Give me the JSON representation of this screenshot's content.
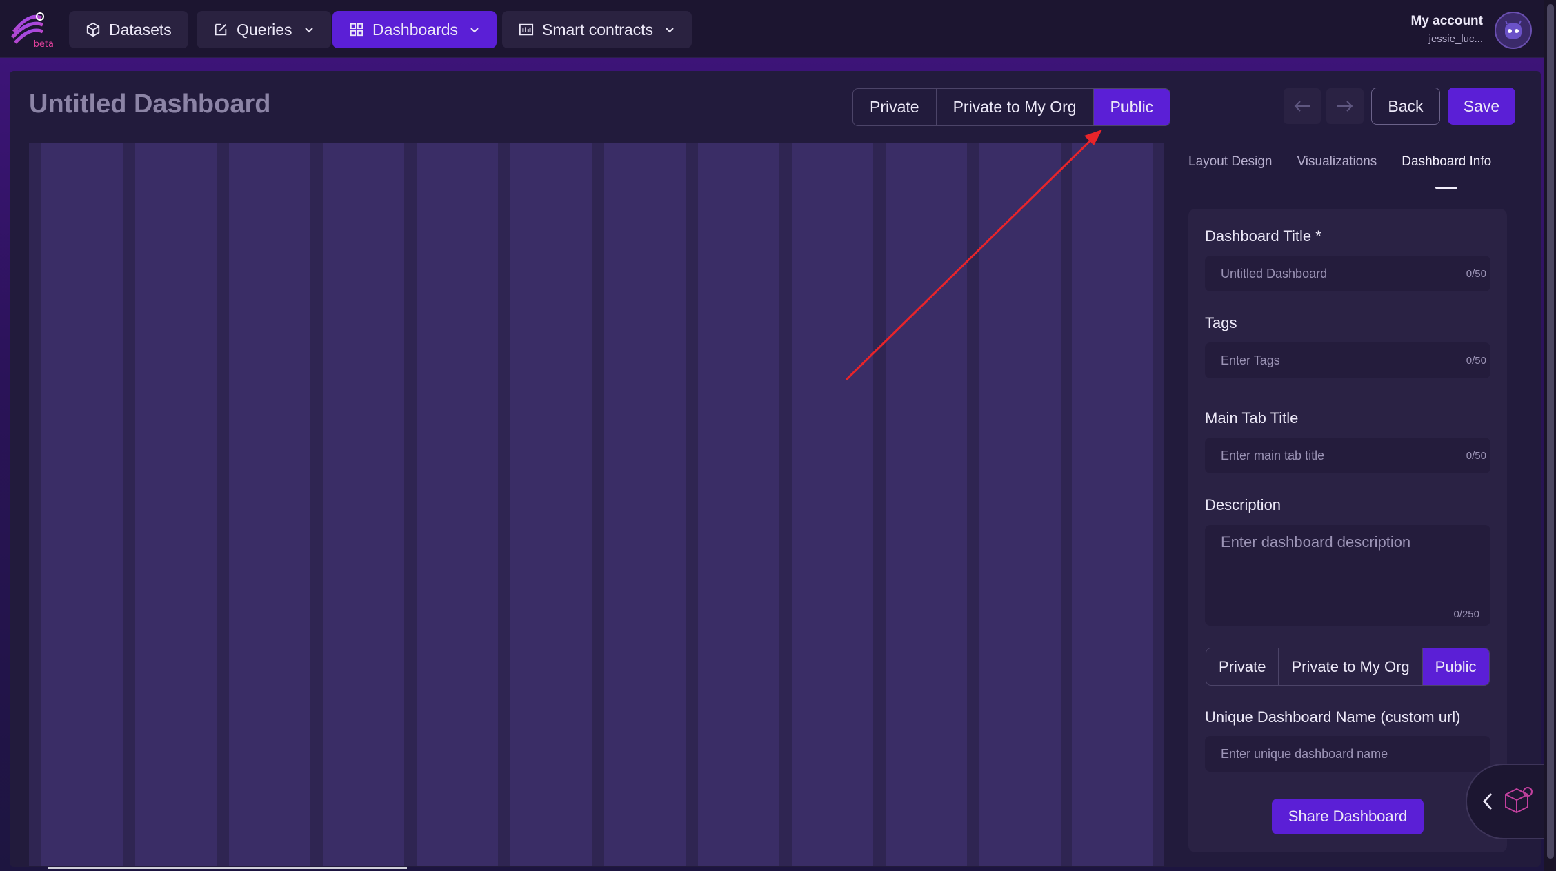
{
  "nav": {
    "logo_badge": "beta",
    "items": [
      {
        "label": "Datasets",
        "icon": "cube-icon",
        "dropdown": false,
        "active": false
      },
      {
        "label": "Queries",
        "icon": "edit-icon",
        "dropdown": true,
        "active": false
      },
      {
        "label": "Dashboards",
        "icon": "grid-icon",
        "dropdown": true,
        "active": true
      },
      {
        "label": "Smart contracts",
        "icon": "bar-chart-icon",
        "dropdown": true,
        "active": false
      }
    ],
    "account_title": "My account",
    "account_user": "jessie_luc..."
  },
  "header": {
    "title": "Untitled Dashboard",
    "visibility_options": [
      "Private",
      "Private to My Org",
      "Public"
    ],
    "visibility_selected": "Public",
    "back_label": "Back",
    "save_label": "Save"
  },
  "sidebar": {
    "tabs": [
      "Layout Design",
      "Visualizations",
      "Dashboard Info"
    ],
    "active_tab": "Dashboard Info",
    "fields": {
      "title_label": "Dashboard Title *",
      "title_placeholder": "Untitled Dashboard",
      "title_count": "0/50",
      "tags_label": "Tags",
      "tags_placeholder": "Enter Tags",
      "tags_count": "0/50",
      "main_tab_label": "Main Tab Title",
      "main_tab_placeholder": "Enter main tab title",
      "main_tab_count": "0/50",
      "description_label": "Description",
      "description_placeholder": "Enter dashboard description",
      "description_count": "0/250",
      "unique_name_label": "Unique Dashboard Name (custom url)",
      "unique_name_placeholder": "Enter unique dashboard name"
    },
    "visibility_options": [
      "Private",
      "Private to My Org",
      "Public"
    ],
    "visibility_selected": "Public",
    "share_label": "Share Dashboard"
  },
  "colors": {
    "accent": "#5b1fd6",
    "background": "#1b1430",
    "annotation_arrow": "#e8242a"
  }
}
